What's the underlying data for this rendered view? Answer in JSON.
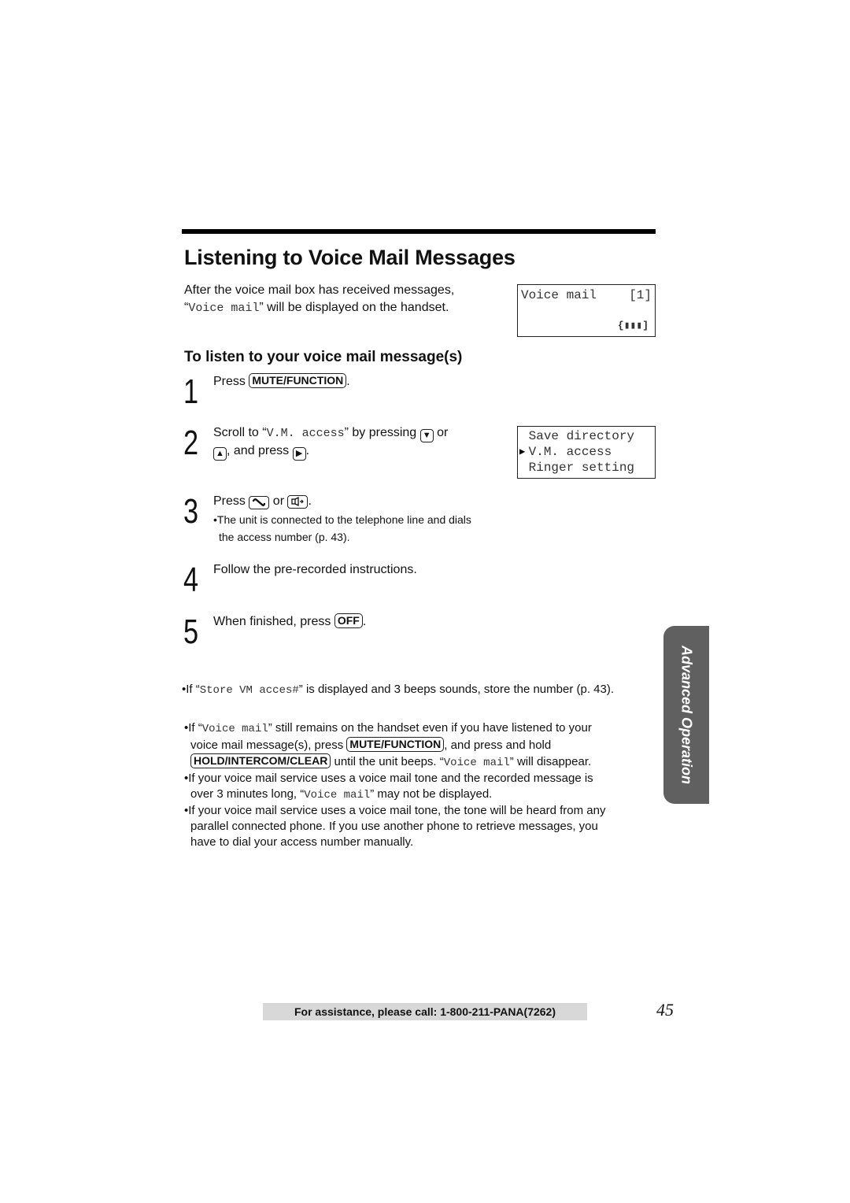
{
  "page": {
    "title": "Listening to Voice Mail Messages",
    "intro": {
      "before": "After the voice mail box has received messages,",
      "quote_open": "“",
      "display_text": "Voice mail",
      "after": "” will be displayed on the handset."
    },
    "lcd_voice_mail": {
      "label": "Voice mail",
      "count": "[1]",
      "battery": "{▮▮▮]",
      "battery_level": "3 of 3 bars"
    },
    "subtitle": "To listen to your voice mail message(s)",
    "steps": [
      {
        "number": "1",
        "text_before": "Press ",
        "key": "MUTE/FUNCTION",
        "text_after": "."
      },
      {
        "number": "2",
        "text_before": "Scroll to “",
        "mono": "V.M. access",
        "text_mid": "” by pressing ",
        "key_down": "▼",
        "text_or": " or",
        "key_up": "▲",
        "text_and": ", and press ",
        "key_right": "▶",
        "text_after": "."
      },
      {
        "number": "3",
        "text_before": "Press ",
        "key_talk": "talk-key",
        "text_or": " or ",
        "key_speaker": "speaker-key",
        "text_after": ".",
        "note_line1": "•The unit is connected to the telephone line and dials",
        "note_line2": "the access number (p. 43)."
      },
      {
        "number": "4",
        "text": "Follow the pre-recorded instructions."
      },
      {
        "number": "5",
        "text_before": "When finished, press ",
        "key": "OFF",
        "text_after": "."
      }
    ],
    "lcd_menu": {
      "items": [
        "Save directory",
        "V.M. access",
        "Ringer setting"
      ],
      "selected": "V.M. access",
      "pointer": "▶"
    },
    "notes": {
      "store": {
        "before": "•If “",
        "mono": "Store VM acces#",
        "after": "” is displayed and 3 beeps sounds, store the number (p. 43)."
      },
      "remains": {
        "l1_before": "•If “",
        "l1_mono": "Voice mail",
        "l1_after": "” still remains on the handset even if you have listened to your",
        "l2_before": "voice mail message(s), press ",
        "l2_key": "MUTE/FUNCTION",
        "l2_after": ", and press and hold",
        "l3_key": "HOLD/INTERCOM/CLEAR",
        "l3_mid": " until the unit beeps. “",
        "l3_mono": "Voice mail",
        "l3_after": "” will disappear."
      },
      "tone_long": {
        "l1": "•If your voice mail service uses a voice mail tone and the recorded message is",
        "l2_before": "over 3 minutes long, “",
        "l2_mono": "Voice mail",
        "l2_after": "” may not be displayed."
      },
      "tone_parallel": {
        "l1": "•If your voice mail service uses a voice mail tone, the tone will be heard from any",
        "l2": "parallel connected phone. If you use another phone to retrieve messages, you",
        "l3": "have to dial your access number manually."
      }
    },
    "side_tab": "Advanced Operation",
    "footer": "For assistance, please call: 1-800-211-PANA(7262)",
    "page_number": "45"
  }
}
